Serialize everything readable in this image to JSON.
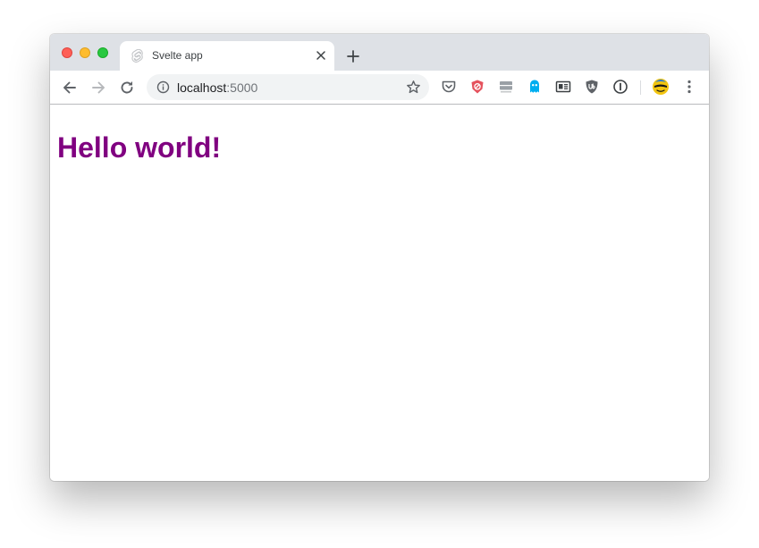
{
  "tab": {
    "title": "Svelte app",
    "favicon_icon": "svelte-icon"
  },
  "toolbar": {
    "back_icon": "arrow-left-icon",
    "forward_icon": "arrow-right-icon",
    "reload_icon": "reload-icon",
    "url_host": "localhost",
    "url_port": ":5000",
    "site_info_icon": "info-icon",
    "bookmark_icon": "star-icon",
    "extensions": [
      "pocket-icon",
      "privacy-shield-icon",
      "screen-capture-icon",
      "ghostery-icon",
      "reader-icon",
      "ublock-icon",
      "onepassword-icon"
    ],
    "profile_icon": "avatar-icon",
    "menu_icon": "kebab-menu-icon"
  },
  "page": {
    "heading": "Hello world!"
  },
  "colors": {
    "heading": "#800080",
    "titlebar": "#dee1e6",
    "omnibox": "#f1f3f4"
  }
}
